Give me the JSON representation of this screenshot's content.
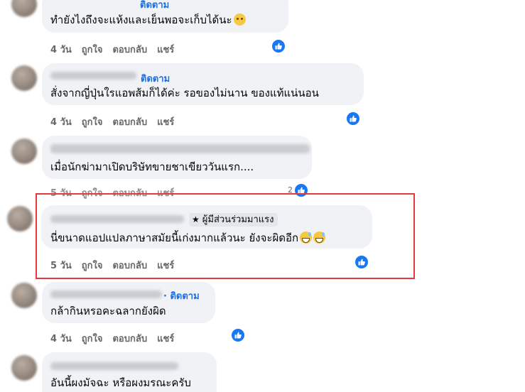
{
  "comments": [
    {
      "follow_label": "ติดตาม",
      "text": "ทำยังไงถึงจะแห้งและเย็นพอจะเก็บได้นะ",
      "emoji": "crying-face",
      "time": "4 วัน",
      "like": "ถูกใจ",
      "reply": "ตอบกลับ",
      "share": "แชร์"
    },
    {
      "follow_label": "ติดตาม",
      "text": "สั่งจากญี่ปุ่นใรแอพส้มก็ได้ค่ะ รอของไม่นาน ของแท้แน่นอน",
      "time": "4 วัน",
      "like": "ถูกใจ",
      "reply": "ตอบกลับ",
      "share": "แชร์"
    },
    {
      "text": "เมื่อนักฆ่ามาเปิดบริษัทขายชาเขียววันแรก....",
      "time": "5 วัน",
      "like": "ถูกใจ",
      "reply": "ตอบกลับ",
      "share": "แชร์",
      "like_count": "2"
    },
    {
      "badge_label": "ผู้มีส่วนร่วมมาแรง",
      "text": "นี่ขนาดแอปแปลภาษาสมัยนี้เก่งมากแล้วนะ ยังจะผิดอีก",
      "emoji": "grinning-sweat-face",
      "time": "5 วัน",
      "like": "ถูกใจ",
      "reply": "ตอบกลับ",
      "share": "แชร์"
    },
    {
      "follow_label": "· ติดตาม",
      "text": "กล้ากินหรอคะฉลากยังผิด",
      "time": "4 วัน",
      "like": "ถูกใจ",
      "reply": "ตอบกลับ",
      "share": "แชร์"
    },
    {
      "text": "อันนี้ผงมัจฉะ หรือผงมรณะครับ"
    }
  ],
  "colors": {
    "accent": "#1877f2",
    "follow": "#216fdb",
    "highlight": "#e33b3b",
    "bubble": "#f0f2f5",
    "muted": "#65676b"
  },
  "icons": {
    "reaction": "thumbs-up-icon",
    "badge": "star-icon"
  }
}
